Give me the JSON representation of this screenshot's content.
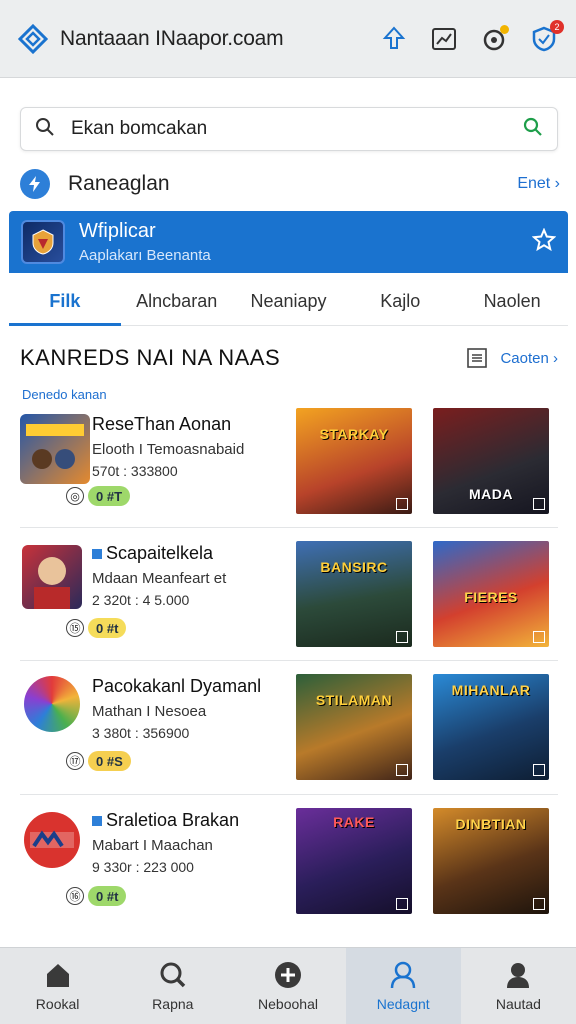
{
  "header": {
    "site_title": "Nantaaan INaapor.coam",
    "notif_badge": "2",
    "icons": [
      "diamond-logo-icon",
      "pin-icon",
      "chart-icon",
      "settings-icon",
      "shield-icon"
    ]
  },
  "search": {
    "placeholder": "Ekan bomcakan"
  },
  "section": {
    "title": "Raneaglan",
    "link": "Enet ›"
  },
  "app_card": {
    "name": "Wfiplicar",
    "subtitle": "Aaplakarı Beenanta"
  },
  "tabs": [
    "Filk",
    "Alncbaran",
    "Neaniapy",
    "Kajlo",
    "Naolen"
  ],
  "list": {
    "title": "KANREDS NAI NA NAAS",
    "link": "Caoten ›",
    "subtitle": "Denedo kanan",
    "rows": [
      {
        "name": "ReseThan Aonan",
        "dev": "Elooth I Temoasnabaid",
        "stats": "570t : 333800",
        "chip_num": "0",
        "chip_text": "#T",
        "shot1": "STARKAY",
        "shot2": "MADA",
        "chip_color": "#f0d04a"
      },
      {
        "name": "Scapaitelkela",
        "dev": "Mdaan Meanfeart et",
        "stats": "2 320t : 4 5.000",
        "chip_num": "0",
        "chip_text": "#t",
        "shot1": "BANSIRC",
        "shot2": "FIERES",
        "chip_color": "#f5dc5a"
      },
      {
        "name": "Pacokakanl Dyamanl",
        "dev": "Mathan I Nesoea",
        "stats": "3 380t : 356900",
        "chip_num": "0",
        "chip_text": "#S",
        "shot1": "STILAMAN",
        "shot2": "MIHANLAR",
        "chip_color": "#f5cf50"
      },
      {
        "name": "Sraletioa Brakan",
        "dev": "Mabart I Maachan",
        "stats": "9 330r : 223 000",
        "chip_num": "0",
        "chip_text": "#t",
        "shot1": "RAKE",
        "shot2": "DINBTIAN",
        "chip_color": "#9ed86a"
      }
    ]
  },
  "nav": [
    {
      "label": "Rookal",
      "icon": "home-icon"
    },
    {
      "label": "Rapna",
      "icon": "search-icon"
    },
    {
      "label": "Neboohal",
      "icon": "add-icon"
    },
    {
      "label": "Nedagnt",
      "icon": "user-icon"
    },
    {
      "label": "Nautad",
      "icon": "profile-icon"
    }
  ],
  "colors": {
    "accent": "#1a73cf",
    "card": "#1a73cf",
    "badge": "#e0312a"
  }
}
